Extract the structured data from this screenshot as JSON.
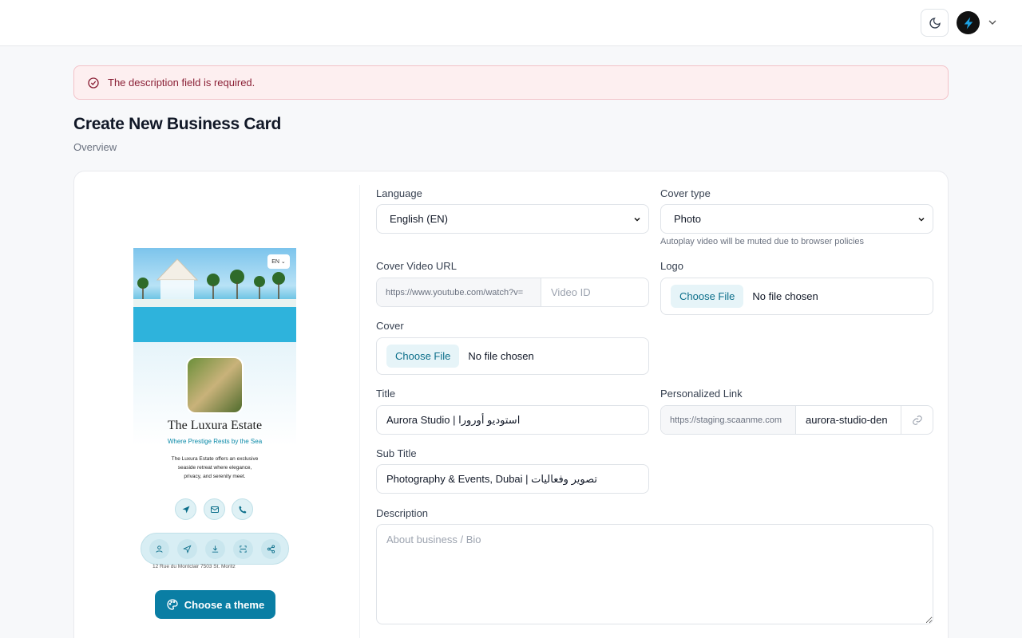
{
  "alert": {
    "message": "The description field is required."
  },
  "page": {
    "title": "Create New Business Card",
    "subtitle": "Overview"
  },
  "form": {
    "language": {
      "label": "Language",
      "value": "English (EN)"
    },
    "cover_type": {
      "label": "Cover type",
      "value": "Photo",
      "hint": "Autoplay video will be muted due to browser policies"
    },
    "cover_video": {
      "label": "Cover Video URL",
      "prefix": "https://www.youtube.com/watch?v=",
      "placeholder": "Video ID"
    },
    "logo": {
      "label": "Logo",
      "button": "Choose File",
      "status": "No file chosen"
    },
    "cover": {
      "label": "Cover",
      "button": "Choose File",
      "status": "No file chosen"
    },
    "title": {
      "label": "Title",
      "value": "Aurora Studio | استوديو أورورا"
    },
    "personalized_link": {
      "label": "Personalized Link",
      "prefix": "https://staging.scaanme.com",
      "value": "aurora-studio-den"
    },
    "sub_title": {
      "label": "Sub Title",
      "value": "Photography & Events, Dubai | تصوير وفعاليات"
    },
    "description": {
      "label": "Description",
      "placeholder": "About business / Bio"
    }
  },
  "preview": {
    "lang_chip": "EN",
    "title": "The Luxura Estate",
    "subtitle": "Where Prestige Rests by the Sea",
    "description": "The Luxura Estate offers an exclusive seaside retreat where elegance, privacy, and serenity meet.",
    "address": "12 Rue du Montclair 7503 St. Moritz"
  },
  "theme_button": {
    "label": "Choose a theme"
  },
  "colors": {
    "accent": "#0a7ea4",
    "alert_bg": "#fdeff0",
    "alert_text": "#8a1f35"
  }
}
